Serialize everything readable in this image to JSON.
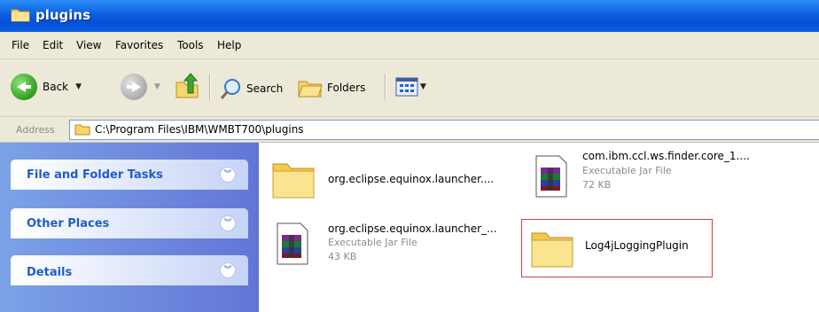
{
  "window": {
    "title": "plugins"
  },
  "menu": {
    "items": [
      {
        "label": "File"
      },
      {
        "label": "Edit"
      },
      {
        "label": "View"
      },
      {
        "label": "Favorites"
      },
      {
        "label": "Tools"
      },
      {
        "label": "Help"
      }
    ]
  },
  "toolbar": {
    "back_label": "Back",
    "search_label": "Search",
    "folders_label": "Folders"
  },
  "address": {
    "label": "Address",
    "value": "C:\\Program Files\\IBM\\WMBT700\\plugins"
  },
  "left_panel": {
    "sections": [
      {
        "label": "File and Folder Tasks"
      },
      {
        "label": "Other Places"
      },
      {
        "label": "Details"
      }
    ]
  },
  "files": [
    {
      "name": "org.eclipse.equinox.launcher....",
      "type": "",
      "size": "",
      "icon": "folder-icon"
    },
    {
      "name": "com.ibm.ccl.ws.finder.core_1....",
      "type": "Executable Jar File",
      "size": "72 KB",
      "icon": "jar-icon"
    },
    {
      "name": "org.eclipse.equinox.launcher_...",
      "type": "Executable Jar File",
      "size": "43 KB",
      "icon": "jar-icon"
    },
    {
      "name": "Log4jLoggingPlugin",
      "type": "",
      "size": "",
      "icon": "folder-icon",
      "selected": true
    }
  ],
  "colors": {
    "title_bar": "#0a5fe0",
    "left_pane": "#7ba2e7",
    "panel_label": "#215dc6",
    "selection_outline": "#d04040"
  }
}
